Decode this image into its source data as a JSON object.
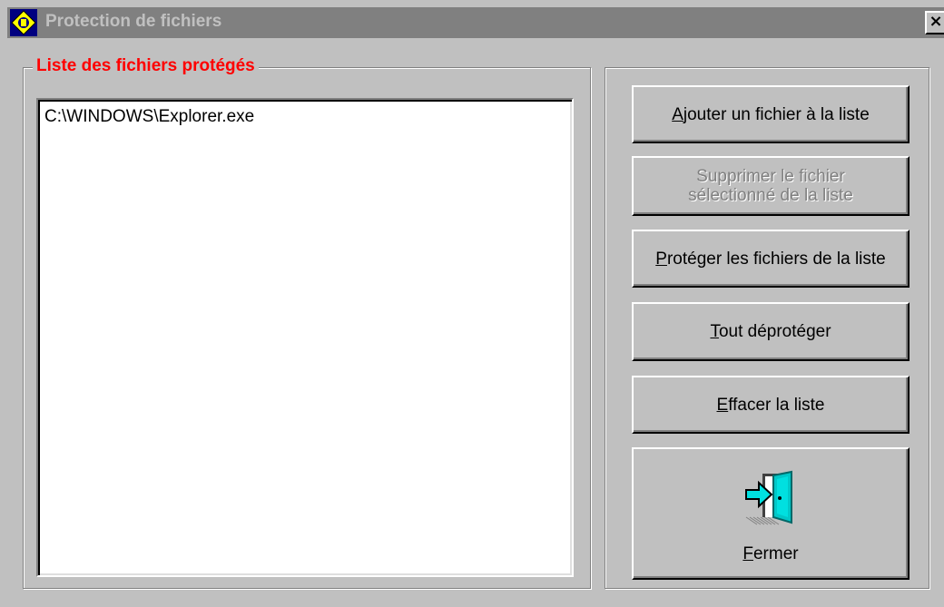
{
  "window": {
    "title": "Protection de fichiers",
    "close_label": "×",
    "icon": "app-shield-icon"
  },
  "group": {
    "legend": "Liste des fichiers protégés",
    "legend_color": "#ff0000"
  },
  "file_list": {
    "items": [
      "C:\\WINDOWS\\Explorer.exe"
    ]
  },
  "buttons": {
    "add": {
      "mnemonic": "A",
      "rest": "jouter un fichier à la liste"
    },
    "remove": {
      "line1": "Supprimer le fichier",
      "line2": "sélectionné de la liste",
      "enabled": false
    },
    "protect": {
      "mnemonic": "P",
      "rest": "rotéger les fichiers de la liste"
    },
    "unprotect_all": {
      "mnemonic": "T",
      "rest": "out déprotéger"
    },
    "clear": {
      "mnemonic": "E",
      "rest": "ffacer la liste"
    },
    "close": {
      "mnemonic": "F",
      "rest": "ermer",
      "icon": "exit-door-icon"
    }
  },
  "colors": {
    "face": "#c0c0c0",
    "titlebar_inactive": "#808080",
    "disabled_text": "#808080"
  }
}
